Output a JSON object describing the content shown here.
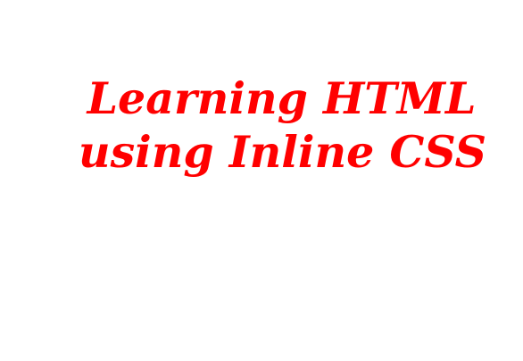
{
  "heading": {
    "line1": "Learning HTML",
    "line2": "using Inline CSS",
    "color": "#ff0000"
  },
  "page": {
    "background": "#ffffff"
  }
}
